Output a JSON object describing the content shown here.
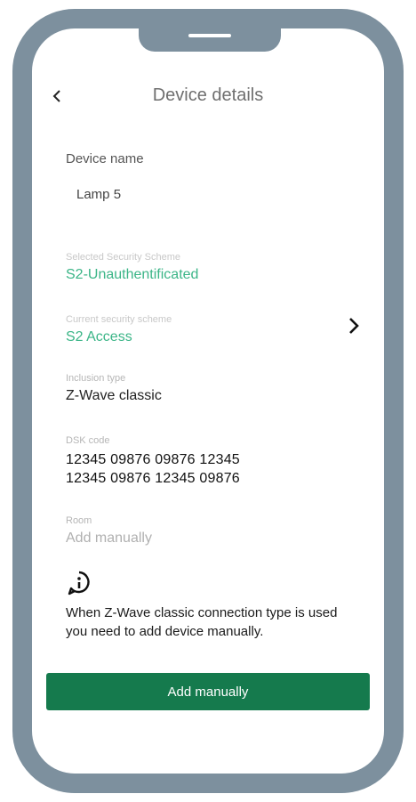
{
  "header": {
    "title": "Device details",
    "back_icon": "chevron-left-icon"
  },
  "device_name": {
    "label": "Device name",
    "value": "Lamp 5"
  },
  "security": {
    "label": "Selected Security Scheme",
    "value": "S2-Unauthentificated"
  },
  "access_level": {
    "label": "Current security scheme",
    "value": "S2 Access",
    "chevron_icon": "chevron-right-icon"
  },
  "connection": {
    "label": "Inclusion type",
    "value": "Z-Wave classic"
  },
  "dsk": {
    "label": "DSK code",
    "line1": "12345 09876 09876 12345",
    "line2": "12345 09876 12345 09876"
  },
  "room": {
    "label": "Room",
    "value": "Add manually"
  },
  "info": {
    "icon": "info-icon",
    "text": "When Z-Wave classic connection type is used you need to add device manually."
  },
  "action": {
    "label": "Add manually"
  },
  "colors": {
    "frame": "#7d909e",
    "accent_green": "#3bb587",
    "button_green": "#157a4d"
  }
}
